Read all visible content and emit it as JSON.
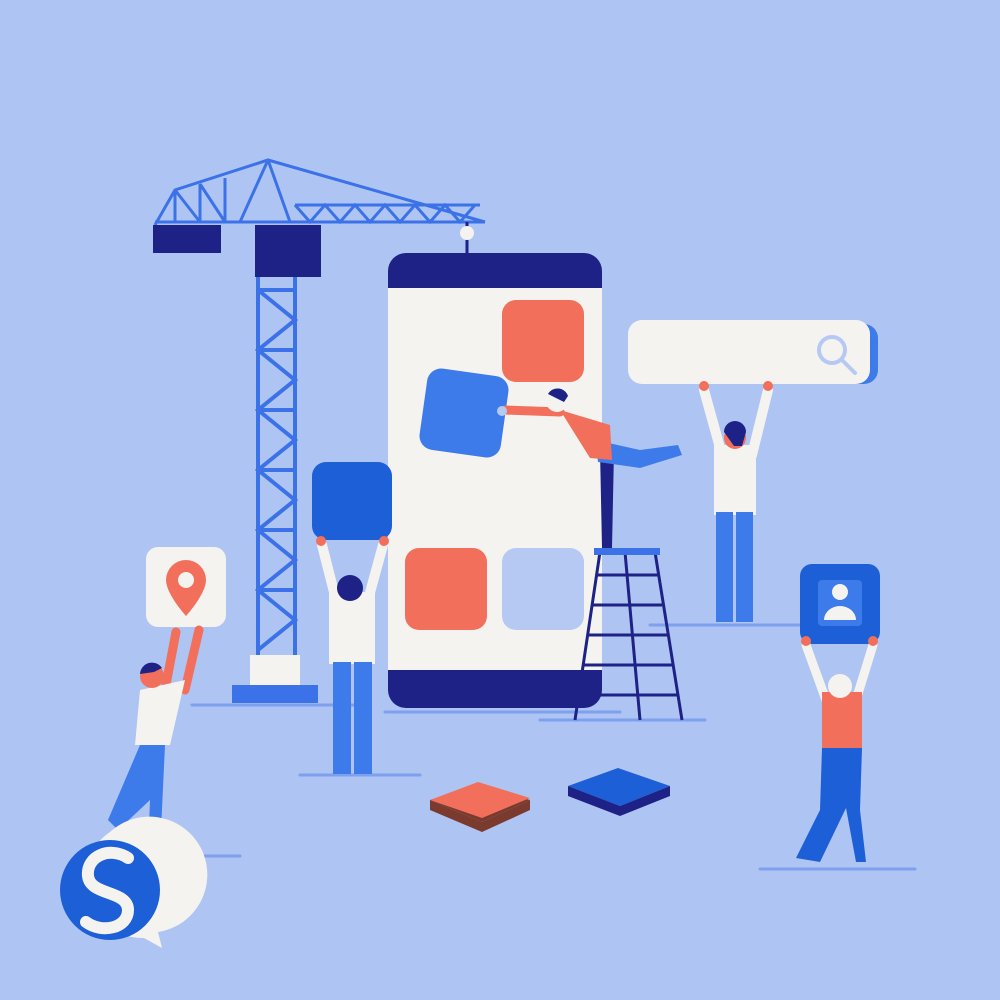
{
  "colors": {
    "background": "#AEC4F2",
    "crane": "#3B72E8",
    "navy": "#1E2185",
    "phone_screen": "#F5F3F0",
    "coral": "#F2705B",
    "blue": "#3D7BEA",
    "royal": "#1D5FD6",
    "light_tile": "#B6C9F2",
    "ground": "#7EA0EE",
    "skin": "#F2705B",
    "shirt": "#F5F3F0"
  },
  "icons": {
    "map_pin": "location-pin-icon",
    "search": "search-icon",
    "user": "user-profile-icon",
    "logo": "speech-bubble-s-logo"
  }
}
